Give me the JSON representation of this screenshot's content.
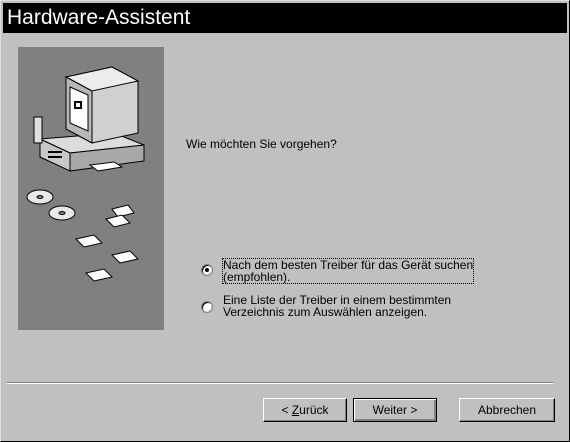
{
  "window": {
    "title": "Hardware-Assistent"
  },
  "main": {
    "question": "Wie möchten Sie vorgehen?"
  },
  "options": [
    {
      "line1": "Nach dem besten Treiber für das Gerät suchen",
      "line2": "(empfohlen).",
      "selected": true
    },
    {
      "line1": "Eine Liste der Treiber in einem bestimmten",
      "line2": "Verzeichnis zum Auswählen anzeigen.",
      "selected": false
    }
  ],
  "buttons": {
    "back_prefix": "< ",
    "back_mnemonic": "Z",
    "back_rest": "urück",
    "next": "Weiter >",
    "cancel": "Abbrechen"
  },
  "colors": {
    "title_bg": "#000000",
    "face": "#c0c0c0",
    "panel": "#808080"
  }
}
